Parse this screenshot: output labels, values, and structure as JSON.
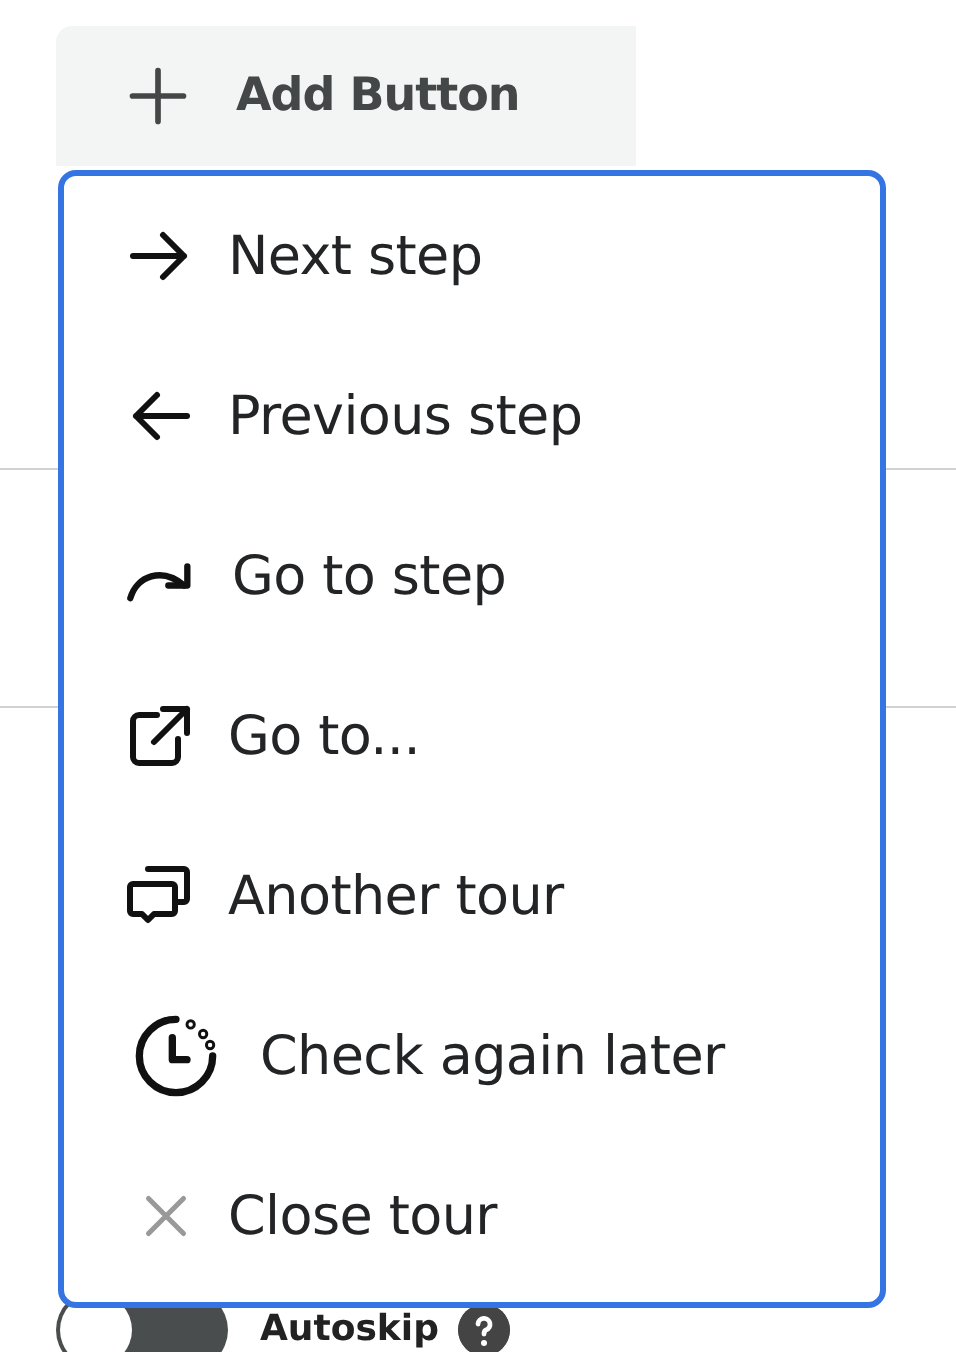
{
  "add_button": {
    "label": "Add Button"
  },
  "menu": {
    "items": [
      {
        "label": "Next step"
      },
      {
        "label": "Previous step"
      },
      {
        "label": "Go to step"
      },
      {
        "label": "Go to..."
      },
      {
        "label": "Another tour"
      },
      {
        "label": "Check again later"
      },
      {
        "label": "Close tour"
      }
    ]
  },
  "autoskip": {
    "label": "Autoskip",
    "on": false
  }
}
